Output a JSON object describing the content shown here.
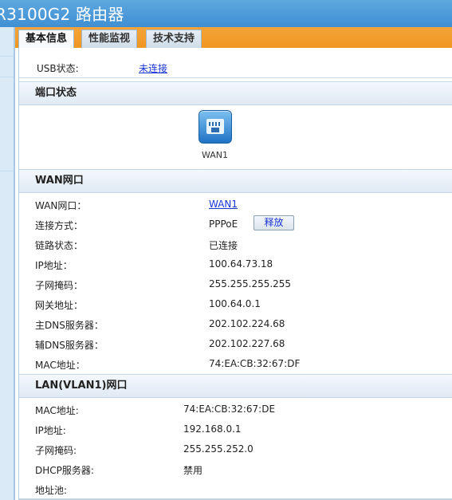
{
  "header": {
    "title": "R3100G2 路由器"
  },
  "tabs": [
    {
      "label": "基本信息",
      "active": true
    },
    {
      "label": "性能监视",
      "active": false
    },
    {
      "label": "技术支持",
      "active": false
    }
  ],
  "usb": {
    "label": "USB状态:",
    "value": "未连接"
  },
  "port_status": {
    "heading": "端口状态",
    "ports": [
      {
        "label": "WAN1",
        "icon": "ethernet-port-icon"
      }
    ]
  },
  "wan": {
    "heading": "WAN网口",
    "rows": [
      {
        "key": "WAN网口：",
        "value": "WAN1"
      },
      {
        "key": "连接方式：",
        "value": "PPPoE"
      },
      {
        "key": "链路状态：",
        "value": "已连接"
      },
      {
        "key": "IP地址：",
        "value": "100.64.73.18"
      },
      {
        "key": "子网掩码：",
        "value": "255.255.255.255"
      },
      {
        "key": "网关地址：",
        "value": "100.64.0.1"
      },
      {
        "key": "主DNS服务器：",
        "value": "202.102.224.68"
      },
      {
        "key": "辅DNS服务器：",
        "value": "202.102.227.68"
      },
      {
        "key": "MAC地址：",
        "value": "74:EA:CB:32:67:DF"
      }
    ],
    "release_label": "释放"
  },
  "lan": {
    "heading": "LAN(VLAN1)网口",
    "rows": [
      {
        "key": "MAC地址:",
        "value": "74:EA:CB:32:67:DE"
      },
      {
        "key": "IP地址:",
        "value": "192.168.0.1"
      },
      {
        "key": "子网掩码:",
        "value": "255.255.252.0"
      },
      {
        "key": "DHCP服务器:",
        "value": "禁用"
      },
      {
        "key": "地址池:",
        "value": ""
      }
    ]
  },
  "colors": {
    "title_bar": "#3f8fd2",
    "tab_strip": "#f0961f",
    "link": "#1a36d6"
  }
}
